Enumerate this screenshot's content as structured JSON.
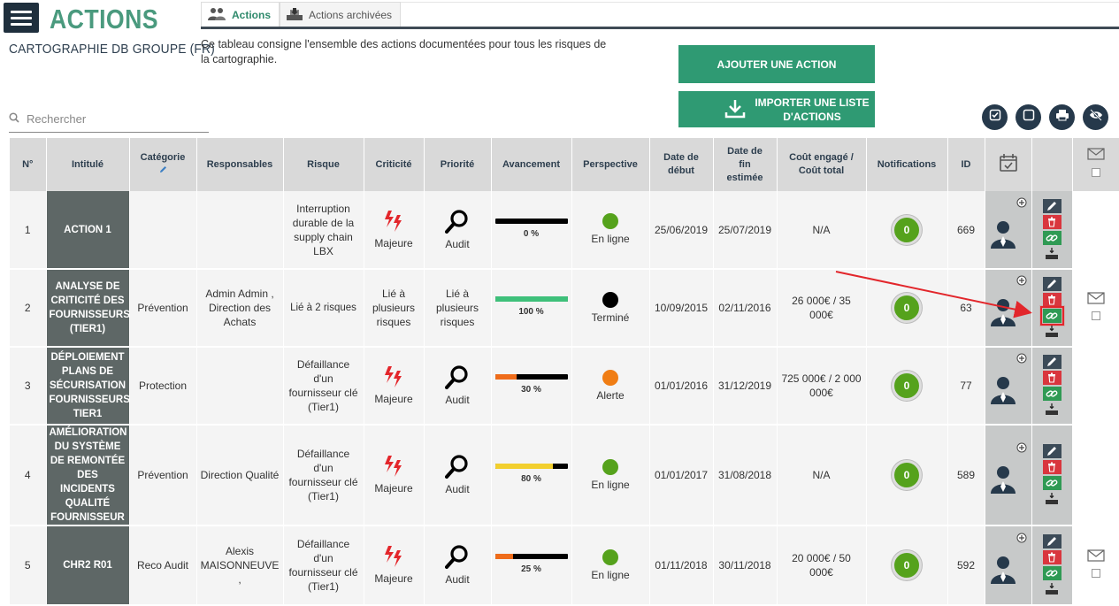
{
  "header": {
    "title": "ACTIONS",
    "subtitle": "CARTOGRAPHIE DB GROUPE (FR)",
    "description": "Ce tableau consigne l'ensemble des actions documentées pour tous les risques de la cartographie.",
    "tabs": [
      {
        "label": "Actions",
        "active": true,
        "icon": "people-icon"
      },
      {
        "label": "Actions archivées",
        "active": false,
        "icon": "archive-icon"
      }
    ]
  },
  "buttons": {
    "add_action": "AJOUTER UNE ACTION",
    "import_line1": "IMPORTER UNE LISTE",
    "import_line2": "D'ACTIONS"
  },
  "search": {
    "placeholder": "Rechercher"
  },
  "toolbar_icons": [
    "check-square-icon",
    "square-icon",
    "print-icon",
    "hide-eye-icon"
  ],
  "table": {
    "headers": {
      "num": "N°",
      "title": "Intitulé",
      "category": "Catégorie",
      "owners": "Responsables",
      "risk": "Risque",
      "criticity": "Criticité",
      "priority": "Priorité",
      "progress": "Avancement",
      "perspective": "Perspective",
      "start1": "Date de",
      "start2": "début",
      "end1": "Date de",
      "end2": "fin",
      "end3": "estimée",
      "cost1": "Coût engagé /",
      "cost2": "Coût total",
      "notifications": "Notifications",
      "id": "ID"
    },
    "rows": [
      {
        "num": "1",
        "title": "ACTION 1",
        "category": "",
        "owners": "",
        "risk": "Interruption durable de la supply chain LBX",
        "risk_muted": false,
        "criticity": "Majeure",
        "criticity_icon": "lightning-icon",
        "priority": "Audit",
        "priority_icon": "magnifier-icon",
        "progress": 0,
        "progress_label": "0 %",
        "progress_color": "#d9d9d9",
        "perspective": "En ligne",
        "perspective_color": "#55a21c",
        "start": "25/06/2019",
        "end": "25/07/2019",
        "cost": "N/A",
        "notifications": "0",
        "id": "669",
        "mail": false
      },
      {
        "num": "2",
        "title": "ANALYSE DE CRITICITÉ DES FOURNISSEURS (TIER1)",
        "category": "Prévention",
        "owners": "Admin Admin , Direction des Achats",
        "risk": "Lié à 2 risques",
        "risk_muted": true,
        "criticity": "Lié à plusieurs risques",
        "criticity_icon": "",
        "priority": "Lié à plusieurs risques",
        "priority_icon": "",
        "progress": 100,
        "progress_label": "100 %",
        "progress_color": "#3ec07a",
        "perspective": "Terminé",
        "perspective_color": "#000000",
        "start": "10/09/2015",
        "end": "02/11/2016",
        "cost": "26 000€ / 35 000€",
        "notifications": "0",
        "id": "63",
        "mail": true
      },
      {
        "num": "3",
        "title": "DÉPLOIEMENT PLANS DE SÉCURISATION FOURNISSEURS TIER1",
        "category": "Protection",
        "owners": "",
        "risk": "Défaillance d'un fournisseur clé (Tier1)",
        "risk_muted": false,
        "criticity": "Majeure",
        "criticity_icon": "lightning-icon",
        "priority": "Audit",
        "priority_icon": "magnifier-icon",
        "progress": 30,
        "progress_label": "30 %",
        "progress_color": "#ef6c1a",
        "perspective": "Alerte",
        "perspective_color": "#f07d14",
        "start": "01/01/2016",
        "end": "31/12/2019",
        "cost": "725 000€ / 2 000 000€",
        "notifications": "0",
        "id": "77",
        "mail": false
      },
      {
        "num": "4",
        "title": "AMÉLIORATION DU SYSTÈME DE REMONTÉE DES INCIDENTS QUALITÉ FOURNISSEUR",
        "category": "Prévention",
        "owners": "Direction Qualité",
        "risk": "Défaillance d'un fournisseur clé (Tier1)",
        "risk_muted": false,
        "criticity": "Majeure",
        "criticity_icon": "lightning-icon",
        "priority": "Audit",
        "priority_icon": "magnifier-icon",
        "progress": 80,
        "progress_label": "80 %",
        "progress_color": "#f2cf2e",
        "perspective": "En ligne",
        "perspective_color": "#55a21c",
        "start": "01/01/2017",
        "end": "31/08/2018",
        "cost": "N/A",
        "notifications": "0",
        "id": "589",
        "mail": false
      },
      {
        "num": "5",
        "title": "CHR2 R01",
        "category": "Reco Audit",
        "owners": "Alexis MAISONNEUVE ,",
        "risk": "Défaillance d'un fournisseur clé (Tier1)",
        "risk_muted": false,
        "criticity": "Majeure",
        "criticity_icon": "lightning-icon",
        "priority": "Audit",
        "priority_icon": "magnifier-icon",
        "progress": 25,
        "progress_label": "25 %",
        "progress_color": "#ef6c1a",
        "perspective": "En ligne",
        "perspective_color": "#55a21c",
        "start": "01/11/2018",
        "end": "30/11/2018",
        "cost": "20 000€ / 50 000€",
        "notifications": "0",
        "id": "592",
        "mail": true
      }
    ]
  },
  "colors": {
    "brand_green": "#4a9a7e",
    "button_green": "#2f9a73",
    "dark_navy": "#26394b",
    "delete_red": "#d9363e",
    "link_green": "#2f9a54",
    "annotation_red": "#e2262b"
  }
}
